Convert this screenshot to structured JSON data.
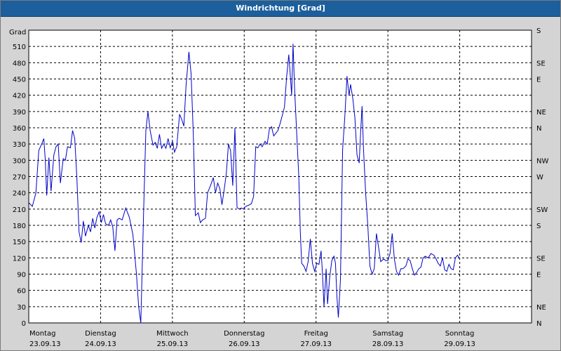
{
  "window": {
    "title": "Windrichtung [Grad]"
  },
  "chart_data": {
    "type": "line",
    "title": "Windrichtung [Grad]",
    "ylabel": "Grad",
    "ylim": [
      0,
      540
    ],
    "yticks": [
      0,
      30,
      60,
      90,
      120,
      150,
      180,
      210,
      240,
      270,
      300,
      330,
      360,
      390,
      420,
      450,
      480,
      510
    ],
    "right_axis_labels": [
      {
        "value": 0,
        "label": "N"
      },
      {
        "value": 30,
        "label": "NE"
      },
      {
        "value": 60,
        "label": ""
      },
      {
        "value": 90,
        "label": "E"
      },
      {
        "value": 120,
        "label": "SE"
      },
      {
        "value": 150,
        "label": ""
      },
      {
        "value": 180,
        "label": "S"
      },
      {
        "value": 210,
        "label": "SW"
      },
      {
        "value": 240,
        "label": ""
      },
      {
        "value": 270,
        "label": "W"
      },
      {
        "value": 300,
        "label": "NW"
      },
      {
        "value": 330,
        "label": ""
      },
      {
        "value": 360,
        "label": "N"
      },
      {
        "value": 390,
        "label": "NE"
      },
      {
        "value": 420,
        "label": ""
      },
      {
        "value": 450,
        "label": "E"
      },
      {
        "value": 480,
        "label": "SE"
      },
      {
        "value": 510,
        "label": ""
      },
      {
        "value": 540,
        "label": "S"
      }
    ],
    "xlim": [
      0,
      7
    ],
    "day_labels": [
      {
        "day": "Montag",
        "date": "23.09.13"
      },
      {
        "day": "Dienstag",
        "date": "24.09.13"
      },
      {
        "day": "Mittwoch",
        "date": "25.09.13"
      },
      {
        "day": "Donnerstag",
        "date": "26.09.13"
      },
      {
        "day": "Freitag",
        "date": "27.09.13"
      },
      {
        "day": "Samstag",
        "date": "28.09.13"
      },
      {
        "day": "Sonntag",
        "date": "29.09.13"
      }
    ],
    "grid": true,
    "series": [
      {
        "color": "#0000c8",
        "points": [
          [
            0.0,
            222
          ],
          [
            0.05,
            215
          ],
          [
            0.1,
            240
          ],
          [
            0.14,
            318
          ],
          [
            0.18,
            330
          ],
          [
            0.21,
            340
          ],
          [
            0.23,
            300
          ],
          [
            0.25,
            235
          ],
          [
            0.28,
            305
          ],
          [
            0.31,
            243
          ],
          [
            0.35,
            310
          ],
          [
            0.38,
            325
          ],
          [
            0.41,
            330
          ],
          [
            0.44,
            258
          ],
          [
            0.48,
            303
          ],
          [
            0.51,
            300
          ],
          [
            0.54,
            325
          ],
          [
            0.58,
            323
          ],
          [
            0.61,
            355
          ],
          [
            0.64,
            340
          ],
          [
            0.67,
            268
          ],
          [
            0.7,
            168
          ],
          [
            0.73,
            148
          ],
          [
            0.76,
            188
          ],
          [
            0.79,
            160
          ],
          [
            0.83,
            180
          ],
          [
            0.86,
            168
          ],
          [
            0.89,
            193
          ],
          [
            0.92,
            175
          ],
          [
            0.95,
            195
          ],
          [
            0.98,
            205
          ],
          [
            1.01,
            185
          ],
          [
            1.04,
            200
          ],
          [
            1.07,
            183
          ],
          [
            1.11,
            180
          ],
          [
            1.14,
            190
          ],
          [
            1.17,
            177
          ],
          [
            1.2,
            133
          ],
          [
            1.23,
            190
          ],
          [
            1.26,
            193
          ],
          [
            1.3,
            190
          ],
          [
            1.35,
            212
          ],
          [
            1.4,
            195
          ],
          [
            1.45,
            163
          ],
          [
            1.5,
            90
          ],
          [
            1.53,
            30
          ],
          [
            1.56,
            0
          ],
          [
            1.6,
            210
          ],
          [
            1.63,
            355
          ],
          [
            1.66,
            390
          ],
          [
            1.69,
            355
          ],
          [
            1.73,
            328
          ],
          [
            1.76,
            333
          ],
          [
            1.79,
            322
          ],
          [
            1.82,
            348
          ],
          [
            1.85,
            322
          ],
          [
            1.88,
            330
          ],
          [
            1.91,
            322
          ],
          [
            1.94,
            340
          ],
          [
            1.97,
            323
          ],
          [
            2.0,
            335
          ],
          [
            2.03,
            315
          ],
          [
            2.06,
            325
          ],
          [
            2.1,
            385
          ],
          [
            2.13,
            375
          ],
          [
            2.16,
            363
          ],
          [
            2.19,
            438
          ],
          [
            2.23,
            500
          ],
          [
            2.26,
            460
          ],
          [
            2.29,
            350
          ],
          [
            2.32,
            198
          ],
          [
            2.36,
            203
          ],
          [
            2.39,
            185
          ],
          [
            2.42,
            190
          ],
          [
            2.46,
            193
          ],
          [
            2.49,
            240
          ],
          [
            2.53,
            253
          ],
          [
            2.57,
            268
          ],
          [
            2.6,
            240
          ],
          [
            2.63,
            258
          ],
          [
            2.66,
            248
          ],
          [
            2.69,
            218
          ],
          [
            2.72,
            245
          ],
          [
            2.75,
            275
          ],
          [
            2.78,
            330
          ],
          [
            2.81,
            318
          ],
          [
            2.84,
            253
          ],
          [
            2.87,
            360
          ],
          [
            2.9,
            213
          ],
          [
            2.93,
            210
          ],
          [
            2.96,
            212
          ],
          [
            2.99,
            210
          ],
          [
            3.02,
            215
          ],
          [
            3.06,
            217
          ],
          [
            3.1,
            220
          ],
          [
            3.13,
            233
          ],
          [
            3.16,
            325
          ],
          [
            3.19,
            323
          ],
          [
            3.22,
            330
          ],
          [
            3.25,
            325
          ],
          [
            3.29,
            335
          ],
          [
            3.32,
            330
          ],
          [
            3.35,
            357
          ],
          [
            3.38,
            362
          ],
          [
            3.41,
            345
          ],
          [
            3.44,
            350
          ],
          [
            3.47,
            355
          ],
          [
            3.5,
            368
          ],
          [
            3.53,
            383
          ],
          [
            3.56,
            398
          ],
          [
            3.59,
            453
          ],
          [
            3.62,
            495
          ],
          [
            3.64,
            460
          ],
          [
            3.66,
            420
          ],
          [
            3.68,
            515
          ],
          [
            3.7,
            435
          ],
          [
            3.73,
            350
          ],
          [
            3.76,
            270
          ],
          [
            3.78,
            170
          ],
          [
            3.8,
            110
          ],
          [
            3.83,
            105
          ],
          [
            3.86,
            95
          ],
          [
            3.89,
            113
          ],
          [
            3.92,
            155
          ],
          [
            3.95,
            110
          ],
          [
            3.98,
            95
          ],
          [
            4.01,
            110
          ],
          [
            4.04,
            108
          ],
          [
            4.07,
            133
          ],
          [
            4.09,
            90
          ],
          [
            4.11,
            30
          ],
          [
            4.14,
            100
          ],
          [
            4.16,
            35
          ],
          [
            4.19,
            85
          ],
          [
            4.22,
            115
          ],
          [
            4.25,
            123
          ],
          [
            4.27,
            110
          ],
          [
            4.29,
            50
          ],
          [
            4.31,
            10
          ],
          [
            4.34,
            80
          ],
          [
            4.37,
            320
          ],
          [
            4.4,
            380
          ],
          [
            4.43,
            455
          ],
          [
            4.46,
            420
          ],
          [
            4.48,
            440
          ],
          [
            4.51,
            415
          ],
          [
            4.54,
            380
          ],
          [
            4.57,
            310
          ],
          [
            4.6,
            295
          ],
          [
            4.62,
            350
          ],
          [
            4.64,
            400
          ],
          [
            4.66,
            323
          ],
          [
            4.69,
            240
          ],
          [
            4.72,
            180
          ],
          [
            4.75,
            105
          ],
          [
            4.78,
            90
          ],
          [
            4.81,
            100
          ],
          [
            4.84,
            165
          ],
          [
            4.87,
            140
          ],
          [
            4.9,
            113
          ],
          [
            4.94,
            118
          ],
          [
            4.97,
            115
          ],
          [
            5.0,
            115
          ],
          [
            5.03,
            128
          ],
          [
            5.06,
            165
          ],
          [
            5.09,
            118
          ],
          [
            5.12,
            95
          ],
          [
            5.15,
            88
          ],
          [
            5.18,
            100
          ],
          [
            5.21,
            100
          ],
          [
            5.25,
            105
          ],
          [
            5.28,
            118
          ],
          [
            5.31,
            115
          ],
          [
            5.34,
            100
          ],
          [
            5.37,
            88
          ],
          [
            5.4,
            93
          ],
          [
            5.43,
            100
          ],
          [
            5.46,
            103
          ],
          [
            5.49,
            120
          ],
          [
            5.52,
            123
          ],
          [
            5.56,
            120
          ],
          [
            5.6,
            128
          ],
          [
            5.64,
            125
          ],
          [
            5.67,
            118
          ],
          [
            5.7,
            110
          ],
          [
            5.73,
            105
          ],
          [
            5.76,
            120
          ],
          [
            5.79,
            98
          ],
          [
            5.82,
            95
          ],
          [
            5.85,
            108
          ],
          [
            5.88,
            100
          ],
          [
            5.91,
            98
          ],
          [
            5.94,
            120
          ],
          [
            5.97,
            125
          ],
          [
            6.0,
            118
          ]
        ]
      }
    ]
  }
}
